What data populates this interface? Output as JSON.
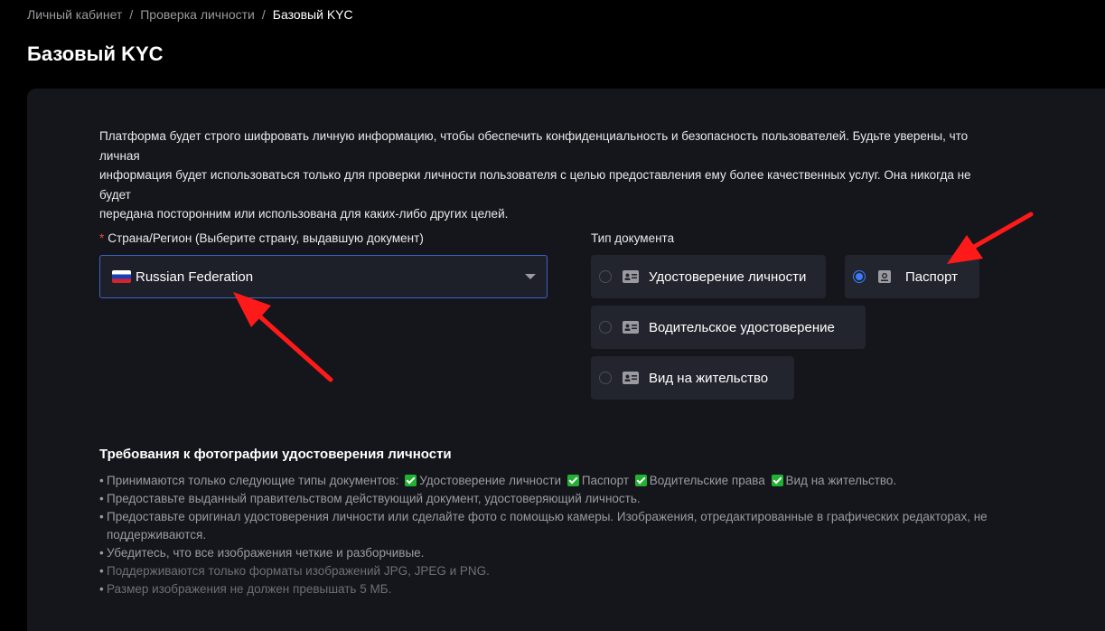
{
  "breadcrumb": {
    "items": [
      "Личный кабинет",
      "Проверка личности",
      "Базовый KYC"
    ],
    "separator": "/"
  },
  "page": {
    "title": "Базовый KYC"
  },
  "intro": {
    "line1": "Платформа будет строго шифровать личную информацию, чтобы обеспечить конфиденциальность и безопасность пользователей. Будьте уверены, что личная",
    "line2": "информация будет использоваться только для проверки личности пользователя с целью предоставления ему более качественных услуг. Она никогда не будет",
    "line3": "передана посторонним или использована для каких-либо других целей."
  },
  "country": {
    "required_mark": "*",
    "label": "Страна/Регион (Выберите страну, выдавшую документ)",
    "selected": "Russian Federation"
  },
  "document": {
    "label": "Тип документа",
    "options": [
      {
        "label": "Удостоверение личности",
        "selected": false
      },
      {
        "label": "Паспорт",
        "selected": true
      },
      {
        "label": "Водительское удостоверение",
        "selected": false
      },
      {
        "label": "Вид на жительство",
        "selected": false
      }
    ]
  },
  "requirements": {
    "title": "Требования к фотографии удостоверения личности",
    "accepted_prefix": "Принимаются только следующие типы документов:",
    "accepted_types": [
      "Удостоверение личности",
      "Паспорт",
      "Водительские права",
      "Вид на жительство."
    ],
    "items": [
      "Предоставьте выданный правительством действующий документ, удостоверяющий личность.",
      "Предоставьте оригинал удостоверения личности или сделайте фото с помощью камеры. Изображения, отредактированные в графических редакторах, не",
      "поддерживаются.",
      "Убедитесь, что все изображения четкие и разборчивые.",
      "Поддерживаются только форматы изображений JPG, JPEG и PNG.",
      "Размер изображения не должен превышать 5 МБ."
    ]
  },
  "colors": {
    "background": "#000000",
    "card": "#15161b",
    "option": "#23252e",
    "accent": "#3a7bff",
    "arrow": "#ff1a1a",
    "check": "#22b033"
  },
  "icons": {
    "document": "id-card-icon",
    "passport": "passport-icon",
    "dropdown": "chevron-down-icon",
    "flag": "russia-flag-icon"
  }
}
